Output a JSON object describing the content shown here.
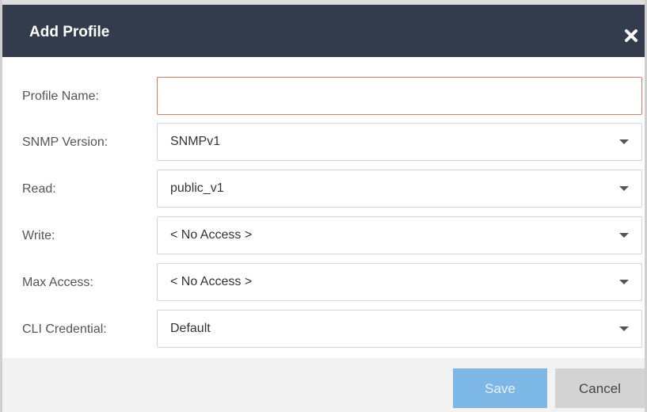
{
  "dialog": {
    "title": "Add Profile",
    "close_icon": "close-x-icon",
    "accent_color": "#323c4c"
  },
  "form": {
    "fields": [
      {
        "label": "Profile Name:",
        "type": "text",
        "value": "",
        "placeholder": ""
      },
      {
        "label": "SNMP Version:",
        "type": "select",
        "value": "SNMPv1"
      },
      {
        "label": "Read:",
        "type": "select",
        "value": "public_v1"
      },
      {
        "label": "Write:",
        "type": "select",
        "value": "< No Access >"
      },
      {
        "label": "Max Access:",
        "type": "select",
        "value": "< No Access >"
      },
      {
        "label": "CLI Credential:",
        "type": "select",
        "value": "Default"
      }
    ]
  },
  "footer": {
    "save_label": "Save",
    "cancel_label": "Cancel",
    "save_color": "#7db7e5",
    "cancel_color": "#d3d3d3"
  }
}
